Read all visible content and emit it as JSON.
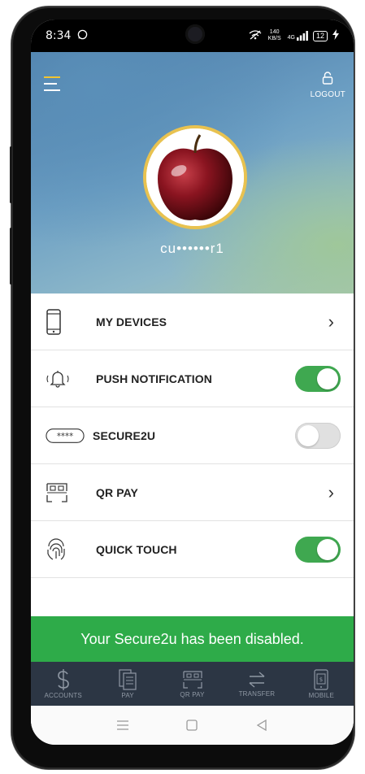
{
  "status_bar": {
    "time": "8:34",
    "network_speed": "140 KB/S",
    "network_type": "4G",
    "battery": "12"
  },
  "header": {
    "logout_label": "LOGOUT",
    "username": "cu••••••r1"
  },
  "settings": [
    {
      "label": "MY DEVICES",
      "icon": "phone-icon",
      "control": "chevron"
    },
    {
      "label": "PUSH NOTIFICATION",
      "icon": "bell-icon",
      "control": "toggle",
      "enabled": true
    },
    {
      "label": "SECURE2U",
      "icon": "secure2u-pin-icon",
      "control": "toggle",
      "enabled": false
    },
    {
      "label": "QR PAY",
      "icon": "qr-code-icon",
      "control": "chevron"
    },
    {
      "label": "QUICK TOUCH",
      "icon": "fingerprint-icon",
      "control": "toggle",
      "enabled": true
    }
  ],
  "snackbar": {
    "message": "Your Secure2u has been disabled."
  },
  "bottom_nav": [
    {
      "label": "ACCOUNTS",
      "icon": "dollar-icon"
    },
    {
      "label": "PAY",
      "icon": "bill-icon"
    },
    {
      "label": "QR PAY",
      "icon": "qr-code-icon"
    },
    {
      "label": "TRANSFER",
      "icon": "transfer-arrows-icon"
    },
    {
      "label": "MOBILE",
      "icon": "mobile-topup-icon"
    }
  ],
  "colors": {
    "accent_green": "#3fa850",
    "snackbar_green": "#2eab49",
    "nav_background": "#2c3644",
    "avatar_ring": "#e8c250"
  }
}
